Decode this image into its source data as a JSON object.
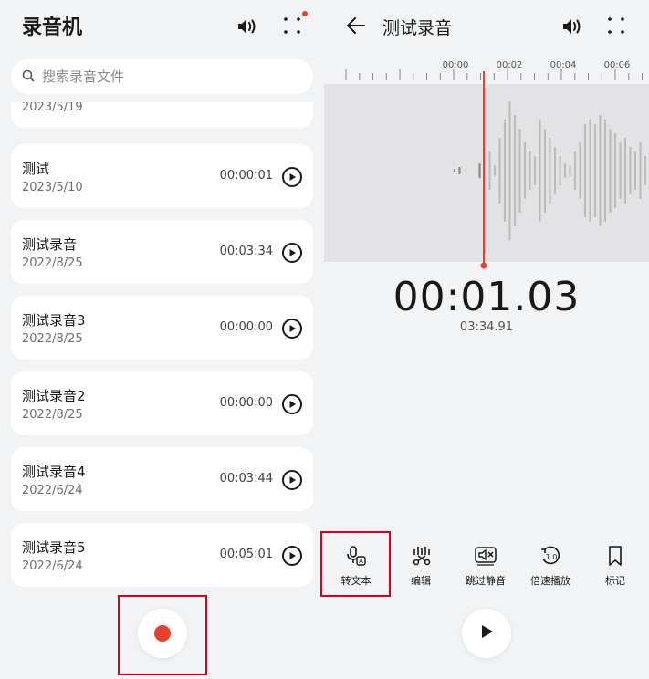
{
  "left": {
    "app_title": "录音机",
    "search_placeholder": "搜索录音文件",
    "partial_date": "2023/5/19",
    "recordings": [
      {
        "name": "测试",
        "date": "2023/5/10",
        "duration": "00:00:01"
      },
      {
        "name": "测试录音",
        "date": "2022/8/25",
        "duration": "00:03:34"
      },
      {
        "name": "测试录音3",
        "date": "2022/8/25",
        "duration": "00:00:00"
      },
      {
        "name": "测试录音2",
        "date": "2022/8/25",
        "duration": "00:00:00"
      },
      {
        "name": "测试录音4",
        "date": "2022/6/24",
        "duration": "00:03:44"
      },
      {
        "name": "测试录音5",
        "date": "2022/6/24",
        "duration": "00:05:01"
      }
    ]
  },
  "right": {
    "title": "测试录音",
    "ruler_labels": [
      "00:00",
      "00:02",
      "00:04",
      "00:06"
    ],
    "current_time": "00:01.03",
    "total_time": "03:34.91",
    "tools": [
      {
        "label": "转文本",
        "icon": "mic-to-text-icon"
      },
      {
        "label": "编辑",
        "icon": "edit-audio-icon"
      },
      {
        "label": "跳过静音",
        "icon": "skip-silence-icon"
      },
      {
        "label": "倍速播放",
        "icon": "playback-speed-icon"
      },
      {
        "label": "标记",
        "icon": "bookmark-icon"
      }
    ],
    "speed_icon_text": "1.0"
  },
  "colors": {
    "accent_red": "#e8412c",
    "highlight_box": "#d9001b",
    "background": "#f1f3f5",
    "waveform_bg": "#e3e3e5"
  }
}
